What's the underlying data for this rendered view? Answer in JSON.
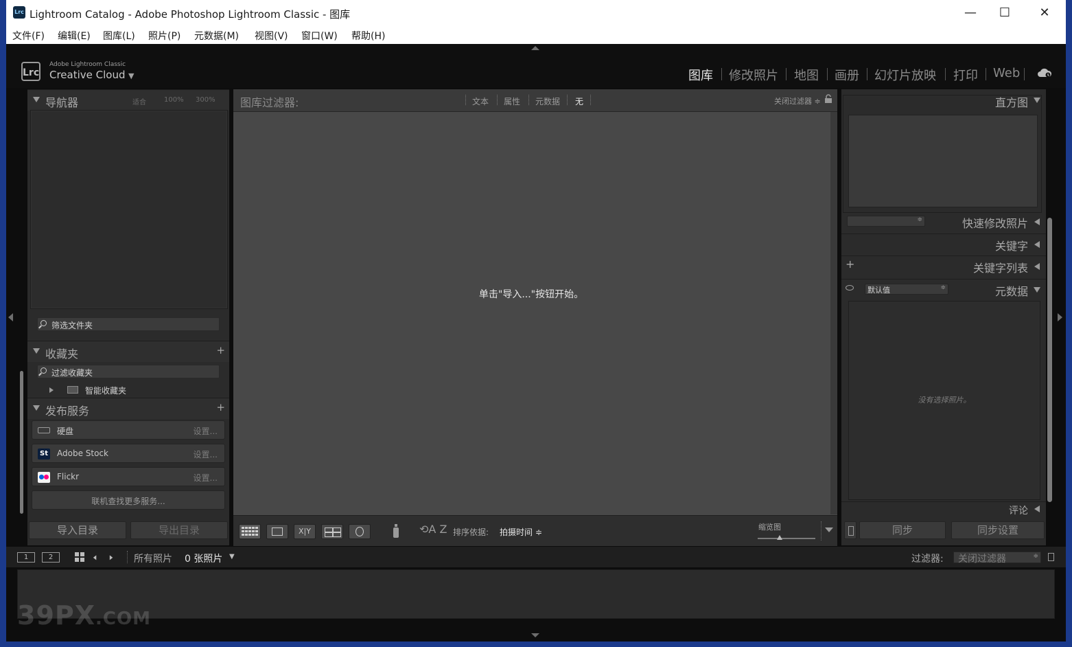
{
  "window": {
    "title": "Lightroom Catalog - Adobe Photoshop Lightroom Classic - 图库"
  },
  "menu": [
    "文件(F)",
    "编辑(E)",
    "图库(L)",
    "照片(P)",
    "元数据(M)",
    "视图(V)",
    "窗口(W)",
    "帮助(H)"
  ],
  "brand": {
    "small": "Adobe Lightroom Classic",
    "big": "Creative Cloud",
    "badge": "Lrc"
  },
  "modules": [
    "图库",
    "修改照片",
    "地图",
    "画册",
    "幻灯片放映",
    "打印",
    "Web"
  ],
  "active_module": "图库",
  "left_panel": {
    "navigator": {
      "title": "导航器",
      "zoom": [
        "适合",
        "100%",
        "300%"
      ]
    },
    "folders": {
      "search": "筛选文件夹"
    },
    "collections": {
      "title": "收藏夹",
      "search": "过滤收藏夹",
      "items": [
        "智能收藏夹"
      ]
    },
    "publish": {
      "title": "发布服务",
      "services": [
        {
          "name": "硬盘",
          "setting": "设置..."
        },
        {
          "name": "Adobe Stock",
          "setting": "设置..."
        },
        {
          "name": "Flickr",
          "setting": "设置..."
        }
      ],
      "more": "联机查找更多服务..."
    },
    "import_button": "导入目录",
    "export_button": "导出目录"
  },
  "filter_bar": {
    "title": "图库过滤器:",
    "items": [
      "文本",
      "属性",
      "元数据",
      "无"
    ],
    "active": "无",
    "filter_off": "关闭过滤器 ≑"
  },
  "center": {
    "message": "单击\"导入...\"按钮开始。"
  },
  "toolbar": {
    "sort_label": "排序依据:",
    "sort_value": "拍摄时间 ≑",
    "thumbnail_label": "缩览图",
    "compare_label": "X|Y"
  },
  "right_panel": {
    "histogram": "直方图",
    "quick_develop": "快速修改照片",
    "keywording": "关键字",
    "keyword_list": "关键字列表",
    "metadata": "元数据",
    "metadata_preset": "默认值",
    "no_photo": "没有选择照片。",
    "comments": "评论",
    "sync_button": "同步",
    "sync_settings_button": "同步设置"
  },
  "filmstrip": {
    "view1": "1",
    "view2": "2",
    "source": "所有照片",
    "count": "0 张照片",
    "filter_label": "过滤器:",
    "filter_value": "关闭过滤器"
  },
  "watermark": {
    "main": "39PX",
    "suffix": ".COM"
  },
  "colors": {
    "panel": "#2b2b2b",
    "center": "#484848",
    "text": "#a8a8a8",
    "active": "#e6e6e6"
  }
}
